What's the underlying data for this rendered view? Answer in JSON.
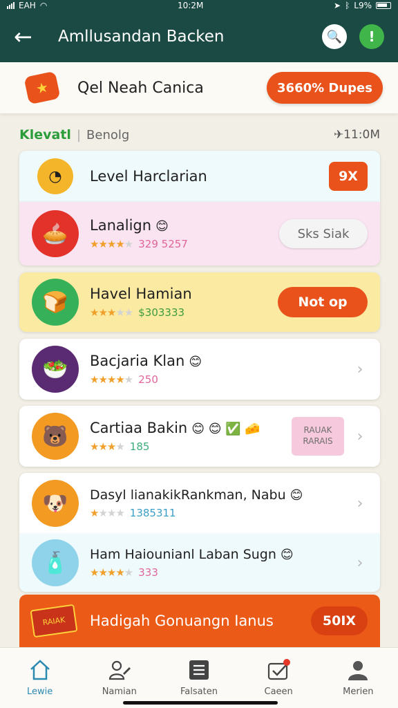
{
  "statusbar": {
    "carrier": "EAH",
    "time": "10:2M",
    "battery": "L9%"
  },
  "appbar": {
    "title": "Amllusandan Backen"
  },
  "promo": {
    "text": "Qel Neah Canica",
    "button": "3660% Dupes"
  },
  "section": {
    "title_green": "Klevatl",
    "title_gray": "Benolg",
    "time": "11:0M"
  },
  "items": [
    {
      "name": "Level Harclarian",
      "action": "9X"
    },
    {
      "name": "Lanalign",
      "emoji": "😊",
      "rating": 4,
      "meta": "329 5257",
      "action": "Sks Siak"
    },
    {
      "name": "Havel Hamian",
      "rating": 3,
      "meta": "$303333",
      "action": "Not op"
    },
    {
      "name": "Bacjaria Klan",
      "emoji": "😊",
      "rating": 4,
      "meta": "250"
    },
    {
      "name": "Cartiaa Bakin",
      "emoji": "😊 😊 ✅ 🧀",
      "rating": 3,
      "meta": "185",
      "tag_line1": "RAUAK",
      "tag_line2": "RARAIS"
    },
    {
      "name": "Dasyl lianakikRankman, Nabu",
      "emoji": "😊",
      "rating": 1,
      "meta": "1385311"
    },
    {
      "name": "Ham Haiounianl Laban Sugn",
      "emoji": "😊",
      "rating": 4,
      "meta": "333"
    }
  ],
  "banner": {
    "text": "Hadigah Gonuangn Ianus",
    "button": "50IX",
    "icon_text": "RAIAK"
  },
  "nav": [
    {
      "label": "Lewie"
    },
    {
      "label": "Namian"
    },
    {
      "label": "Falsaten"
    },
    {
      "label": "Caeen"
    },
    {
      "label": "Merien"
    }
  ]
}
